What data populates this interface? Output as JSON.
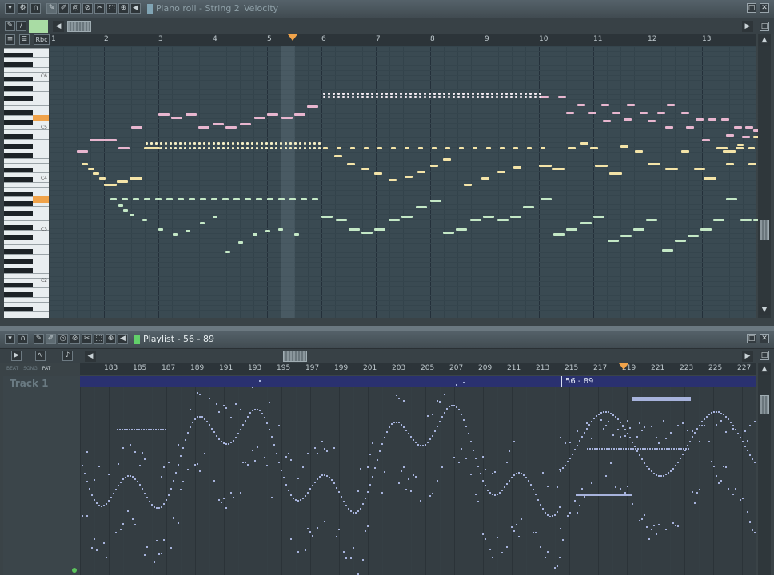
{
  "piano_roll": {
    "title": "Piano roll - String 2",
    "target": "Velocity",
    "ruler": [
      "1",
      "2",
      "3",
      "4",
      "5",
      "6",
      "7",
      "8",
      "9",
      "10",
      "11",
      "12",
      "13"
    ],
    "keyboard_label": "Rbc",
    "octave_labels": [
      "C6",
      "C5",
      "C4",
      "C3",
      "C2"
    ]
  },
  "playlist": {
    "title": "Playlist - 56 - 89",
    "mode_tabs": [
      "BEAT",
      "SONG",
      "PAT"
    ],
    "ruler": [
      "183",
      "185",
      "187",
      "189",
      "191",
      "193",
      "195",
      "197",
      "199",
      "201",
      "203",
      "205",
      "207",
      "209",
      "211",
      "213",
      "215",
      "217",
      "219",
      "221",
      "223",
      "225",
      "227"
    ],
    "track": "Track 1",
    "clip_label": "56 - 89"
  },
  "colors": {
    "accent": "#f0a34a",
    "note_pink": "#e8b6cf",
    "note_yellow": "#f4e4a8",
    "note_green": "#c4e8c6",
    "playlist_note": "#a7b3dc"
  }
}
